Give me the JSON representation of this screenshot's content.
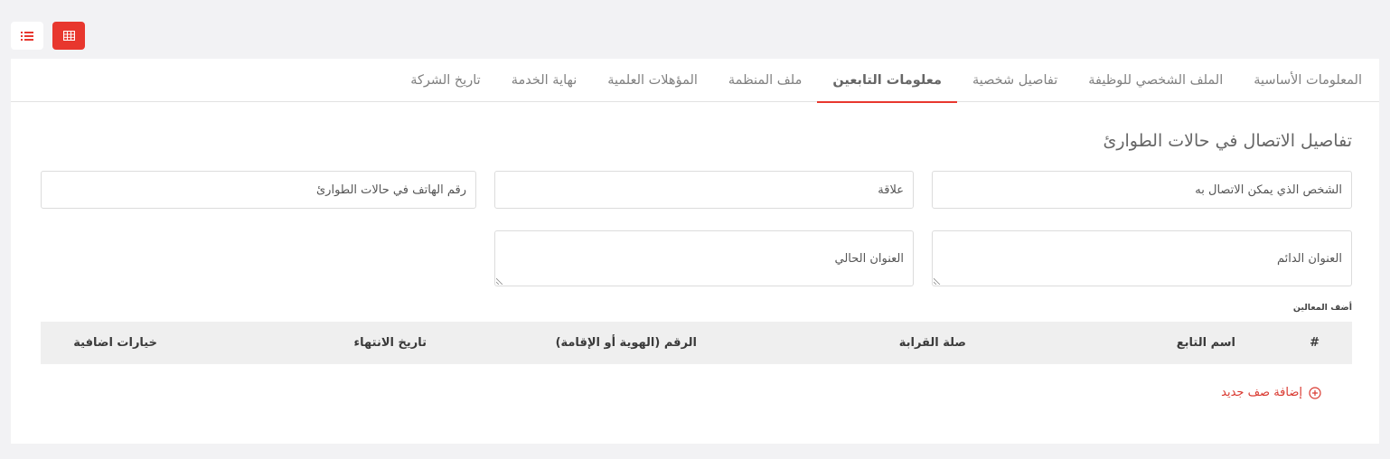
{
  "view_toggle": {
    "list_icon": "list-icon",
    "grid_icon": "table-grid-icon",
    "accent": "#e8372e"
  },
  "tabs": [
    {
      "label": "المعلومات الأساسية",
      "active": false
    },
    {
      "label": "الملف الشخصي للوظيفة",
      "active": false
    },
    {
      "label": "تفاصيل شخصية",
      "active": false
    },
    {
      "label": "معلومات التابعين",
      "active": true
    },
    {
      "label": "ملف المنظمة",
      "active": false
    },
    {
      "label": "المؤهلات العلمية",
      "active": false
    },
    {
      "label": "نهاية الخدمة",
      "active": false
    },
    {
      "label": "تاريخ الشركة",
      "active": false
    }
  ],
  "emergency": {
    "title": "تفاصيل الاتصال في حالات الطوارئ",
    "contact_person_placeholder": "الشخص الذي يمكن الاتصال به",
    "relationship_placeholder": "علاقة",
    "emergency_phone_placeholder": "رقم الهاتف في حالات الطوارئ",
    "permanent_address_placeholder": "العنوان الدائم",
    "current_address_placeholder": "العنوان الحالي"
  },
  "dependents": {
    "caption": "أضف المعالين",
    "columns": {
      "index": "#",
      "name": "اسم التابع",
      "relation": "صلة القرابة",
      "id_number": "الرقم (الهوية أو الإقامة)",
      "expiry": "تاريخ الانتهاء",
      "options": "خيارات اضافية"
    },
    "rows": [],
    "add_row_label": "إضافة صف جديد",
    "add_row_icon": "plus-circle-icon"
  }
}
